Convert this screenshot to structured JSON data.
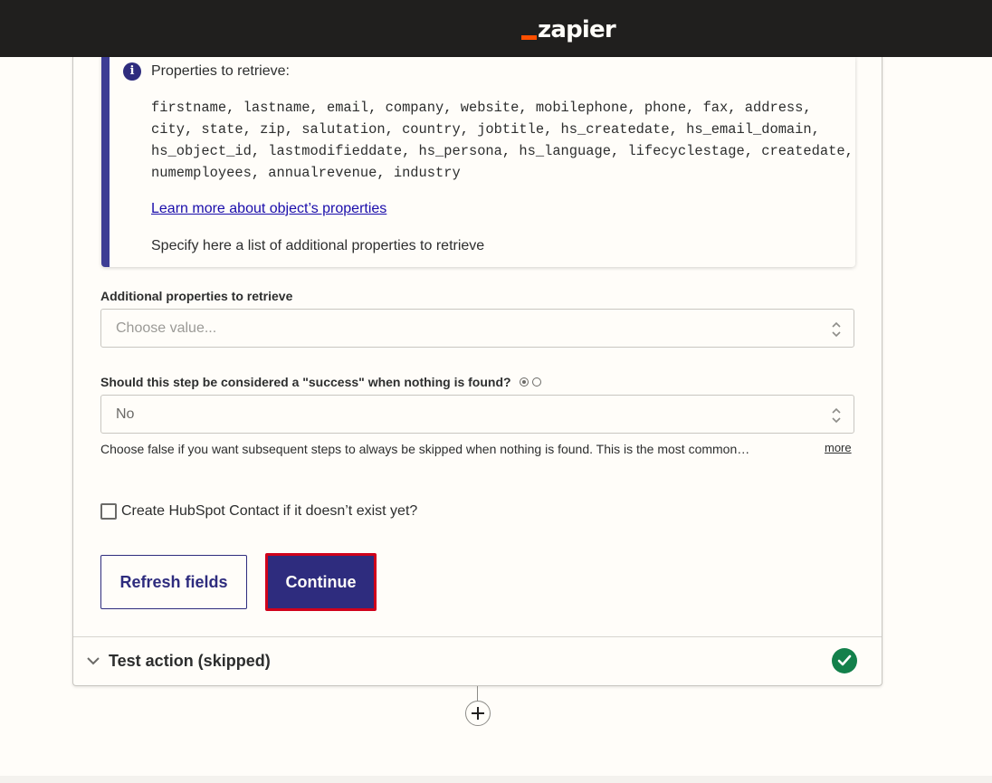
{
  "header": {
    "logo_text": "zapier",
    "logo_accent_color": "#ff4f00"
  },
  "info_box": {
    "icon": "info-icon",
    "title": "Properties to retrieve:",
    "properties": "firstname, lastname, email, company, website, mobilephone, phone, fax, address, city, state, zip, salutation, country, jobtitle, hs_createdate, hs_email_domain, hs_object_id, lastmodifieddate, hs_persona, hs_language, lifecyclestage, createdate, numemployees, annualrevenue, industry",
    "link": "Learn more about object’s properties",
    "specify": "Specify here a list of additional properties to retrieve"
  },
  "additional_properties": {
    "label": "Additional properties to retrieve",
    "placeholder": "Choose value..."
  },
  "success_field": {
    "label": "Should this step be considered a \"success\" when nothing is found?",
    "value": "No",
    "help": "Choose false if you want subsequent steps to always be skipped when nothing is found. This is the most common…",
    "more": "more"
  },
  "create_contact": {
    "label": "Create HubSpot Contact if it doesn’t exist yet?",
    "checked": false
  },
  "buttons": {
    "refresh": "Refresh fields",
    "continue": "Continue"
  },
  "test_section": {
    "label": "Test action (skipped)",
    "status_icon": "check-circle-icon",
    "status_color": "#13804b"
  },
  "colors": {
    "primary": "#2e2c7e",
    "highlight": "#d0021b"
  }
}
